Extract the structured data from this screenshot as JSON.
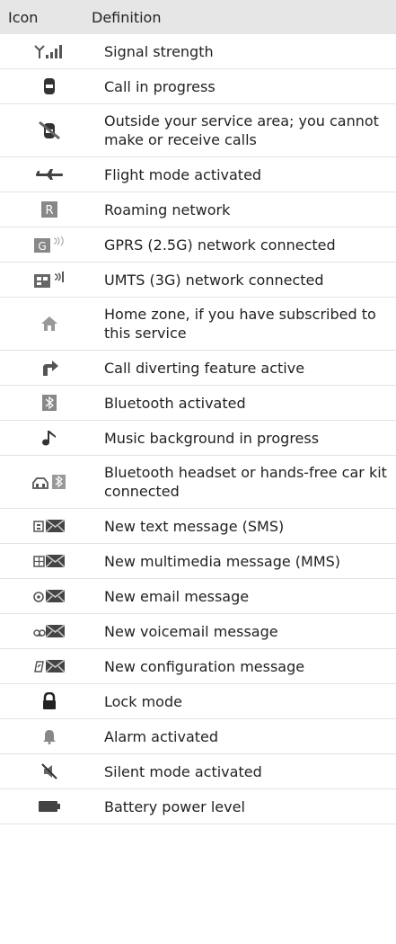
{
  "table": {
    "header_icon": "Icon",
    "header_definition": "Definition",
    "rows": [
      {
        "icon": "signal-strength-icon",
        "definition": "Signal strength"
      },
      {
        "icon": "call-in-progress-icon",
        "definition": "Call in progress"
      },
      {
        "icon": "no-service-icon",
        "definition": "Outside your service area; you cannot make or receive calls"
      },
      {
        "icon": "flight-mode-icon",
        "definition": "Flight mode activated"
      },
      {
        "icon": "roaming-icon",
        "definition": "Roaming network"
      },
      {
        "icon": "gprs-icon",
        "definition": "GPRS (2.5G) network connected"
      },
      {
        "icon": "umts-icon",
        "definition": "UMTS (3G) network connected"
      },
      {
        "icon": "home-zone-icon",
        "definition": "Home zone, if you have subscribed to this service"
      },
      {
        "icon": "call-divert-icon",
        "definition": "Call diverting feature active"
      },
      {
        "icon": "bluetooth-icon",
        "definition": "Bluetooth activated"
      },
      {
        "icon": "music-note-icon",
        "definition": "Music background in progress"
      },
      {
        "icon": "bluetooth-headset-icon",
        "definition": "Bluetooth headset or hands-free car kit connected"
      },
      {
        "icon": "sms-icon",
        "definition": "New text message (SMS)"
      },
      {
        "icon": "mms-icon",
        "definition": "New multimedia message (MMS)"
      },
      {
        "icon": "email-icon",
        "definition": "New email message"
      },
      {
        "icon": "voicemail-icon",
        "definition": "New voicemail message"
      },
      {
        "icon": "config-message-icon",
        "definition": "New configuration message"
      },
      {
        "icon": "lock-icon",
        "definition": "Lock mode"
      },
      {
        "icon": "alarm-bell-icon",
        "definition": "Alarm activated"
      },
      {
        "icon": "silent-mode-icon",
        "definition": "Silent mode activated"
      },
      {
        "icon": "battery-icon",
        "definition": "Battery power level"
      }
    ]
  }
}
